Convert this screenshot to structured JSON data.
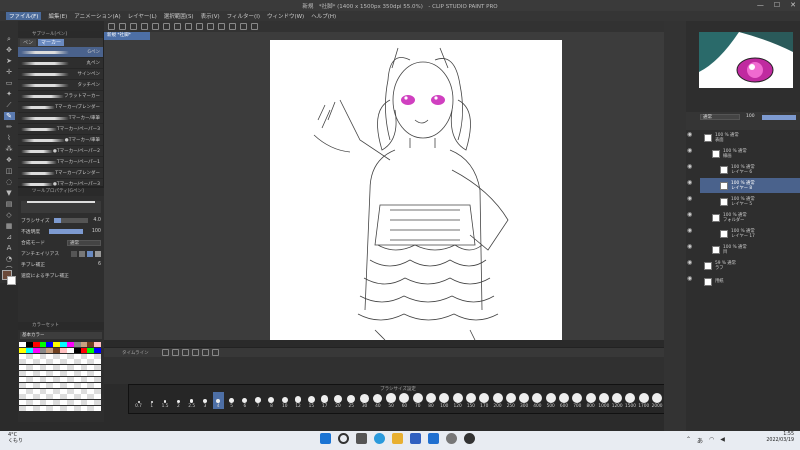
{
  "window": {
    "title": "新規　*社脚* (1400 x 1500px 350dpi 55.0%)　- CLIP STUDIO PAINT PRO",
    "controls": [
      "—",
      "☐",
      "✕"
    ]
  },
  "menu": [
    "ファイル(F)",
    "編集(E)",
    "アニメーション(A)",
    "レイヤー(L)",
    "選択範囲(S)",
    "表示(V)",
    "フィルター(I)",
    "ウィンドウ(W)",
    "ヘルプ(H)"
  ],
  "subtool": {
    "title": "サブツール[ペン]",
    "tabs": [
      "ペン",
      "マーカー"
    ],
    "brushes": [
      "Gペン",
      "丸ペン",
      "サインペン",
      "タッチペン",
      "フラットマーカー",
      "Tマーカー/ブレンダー",
      "Tマーカー/車筆",
      "Tマーカー/ペーパー3",
      "●Tマーカー/車筆",
      "●Tマーカー/ペーパー2",
      "Tマーカー/ペーパー1",
      "Tマーカー/ブレンダー",
      "●Tマーカー/ペーパー3"
    ]
  },
  "toolprop": {
    "title": "ツールプロパティ[Gペン]",
    "rows": [
      {
        "label": "ブラシサイズ",
        "value": "4.0"
      },
      {
        "label": "不透明度",
        "value": "100"
      },
      {
        "label": "合成モード",
        "value": "通常"
      },
      {
        "label": "アンチエイリアス",
        "value": ""
      },
      {
        "label": "手ブレ補正",
        "value": "6"
      },
      {
        "label": "速度による手ブレ補正",
        "value": ""
      }
    ]
  },
  "color_panel": {
    "title": "カラーセット",
    "set_name": "基本カラー"
  },
  "doc_tab": "新規 *社脚*",
  "timeline": {
    "title": "タイムライン"
  },
  "onion": {
    "title": "ブラシサイズ設定",
    "values": [
      "0.7",
      "1",
      "1.5",
      "2",
      "2.5",
      "3",
      "4",
      "5",
      "6",
      "7",
      "8",
      "10",
      "12",
      "15",
      "17",
      "20",
      "25",
      "30",
      "40",
      "50",
      "60",
      "70",
      "80",
      "100",
      "120",
      "150",
      "170",
      "200",
      "250",
      "300",
      "400",
      "500",
      "600",
      "700",
      "800",
      "1000",
      "1200",
      "1500",
      "1700",
      "2000"
    ],
    "selected": "4"
  },
  "layers": {
    "blend": "通常",
    "opacity": "100",
    "items": [
      {
        "name": "100 % 通常",
        "sub": "表面",
        "indent": 0
      },
      {
        "name": "100 % 通常",
        "sub": "線画",
        "indent": 1
      },
      {
        "name": "100 % 通常",
        "sub": "レイヤー 6",
        "indent": 2
      },
      {
        "name": "100 % 通常",
        "sub": "レイヤー 8",
        "indent": 2,
        "selected": true
      },
      {
        "name": "100 % 通常",
        "sub": "レイヤー 5",
        "indent": 2
      },
      {
        "name": "100 % 通常",
        "sub": "フォルダー",
        "indent": 1
      },
      {
        "name": "100 % 通常",
        "sub": "レイヤー 17",
        "indent": 2
      },
      {
        "name": "100 % 通常",
        "sub": "目",
        "indent": 1
      },
      {
        "name": "59 % 通常",
        "sub": "ラフ",
        "indent": 0
      },
      {
        "name": "",
        "sub": "用紙",
        "indent": 0
      }
    ]
  },
  "taskbar": {
    "weather_temp": "4°C",
    "weather_desc": "くもり",
    "time": "1:55",
    "date": "2022/03/19"
  },
  "colors": {
    "accent": "#4d6fa6",
    "main_color": "#6b4a3a",
    "sub_color": "#ffffff"
  }
}
